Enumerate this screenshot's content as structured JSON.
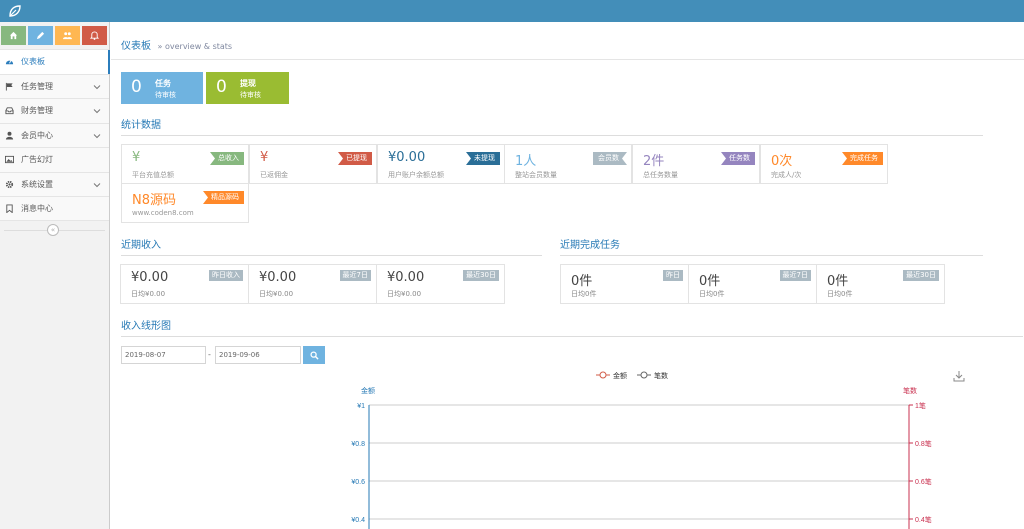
{
  "colors": {
    "navbar": "#438eb9",
    "accent": "#2679b5"
  },
  "shortcuts": [
    {
      "name": "home",
      "color": "#87b87f"
    },
    {
      "name": "pencil",
      "color": "#6fb3e0"
    },
    {
      "name": "group",
      "color": "#ffb752"
    },
    {
      "name": "bell",
      "color": "#d15b47"
    }
  ],
  "menu": [
    {
      "label": "仪表板",
      "icon": "dashboard-icon",
      "active": true
    },
    {
      "label": "任务管理",
      "icon": "flag-icon"
    },
    {
      "label": "财务管理",
      "icon": "inbox-icon"
    },
    {
      "label": "会员中心",
      "icon": "user-icon"
    },
    {
      "label": "广告幻灯",
      "icon": "picture-icon"
    },
    {
      "label": "系统设置",
      "icon": "gear-icon"
    },
    {
      "label": "消息中心",
      "icon": "bookmark-icon"
    }
  ],
  "breadcrumb": {
    "title": "仪表板",
    "subtitle": "» overview & stats"
  },
  "tiles": [
    {
      "value": "0",
      "line1": "任务",
      "line2": "待审核",
      "color": "#6fb3e0"
    },
    {
      "value": "0",
      "line1": "提现",
      "line2": "待审核",
      "color": "#9abc32"
    }
  ],
  "stats_title": "统计数据",
  "stats": [
    {
      "value": "¥",
      "label": "平台充值总额",
      "tag": "总收入",
      "tag_color": "#87b87f",
      "value_color": "#87b87f",
      "ribbon": "l"
    },
    {
      "value": "¥",
      "label": "已返佣金",
      "tag": "已提现",
      "tag_color": "#d15b47",
      "value_color": "#d15b47",
      "ribbon": "l"
    },
    {
      "value": "¥0.00",
      "label": "用户账户余额总额",
      "tag": "未提现",
      "tag_color": "#2a6e97",
      "value_color": "#2a6e97",
      "ribbon": "l"
    },
    {
      "value": "1人",
      "label": "整站会员数量",
      "tag": "会员数",
      "tag_color": "#abbac3",
      "value_color": "#6fb3e0",
      "ribbon": "r"
    },
    {
      "value": "2件",
      "label": "总任务数量",
      "tag": "任务数",
      "tag_color": "#9585bf",
      "value_color": "#9585bf",
      "ribbon": "l"
    },
    {
      "value": "0次",
      "label": "完成人/次",
      "tag": "完成任务",
      "tag_color": "#ff892a",
      "value_color": "#ff892a",
      "ribbon": "l"
    },
    {
      "value": "N8源码",
      "label": "www.coden8.com",
      "tag": "精品源码",
      "tag_color": "#ff892a",
      "value_color": "#ff892a",
      "ribbon": "l"
    }
  ],
  "income_title": "近期收入",
  "income": [
    {
      "value": "¥0.00",
      "sub": "日均¥0.00",
      "tag": "昨日收入"
    },
    {
      "value": "¥0.00",
      "sub": "日均¥0.00",
      "tag": "最近7日"
    },
    {
      "value": "¥0.00",
      "sub": "日均¥0.00",
      "tag": "最近30日"
    }
  ],
  "tasks_title": "近期完成任务",
  "tasks": [
    {
      "value": "0件",
      "sub": "日均0件",
      "tag": "昨日"
    },
    {
      "value": "0件",
      "sub": "日均0件",
      "tag": "最近7日"
    },
    {
      "value": "0件",
      "sub": "日均0件",
      "tag": "最近30日"
    }
  ],
  "line_title": "收入线形图",
  "date_from": "2019-08-07",
  "date_sep": "-",
  "date_to": "2019-09-06",
  "chart_data": {
    "type": "line",
    "series": [
      {
        "name": "金额",
        "color": "#d15b47",
        "values": []
      },
      {
        "name": "笔数",
        "color": "#666666",
        "values": []
      }
    ],
    "ylabel_left": "金额",
    "ylabel_right": "笔数",
    "left_color": "#2679b5",
    "right_color": "#c9304f",
    "left_ticks": [
      "¥1",
      "¥0.8",
      "¥0.6",
      "¥0.4"
    ],
    "right_ticks": [
      "1笔",
      "0.8笔",
      "0.6笔",
      "0.4笔"
    ],
    "ylim": [
      0,
      1
    ],
    "grid": true,
    "legend_position": "top-center"
  }
}
